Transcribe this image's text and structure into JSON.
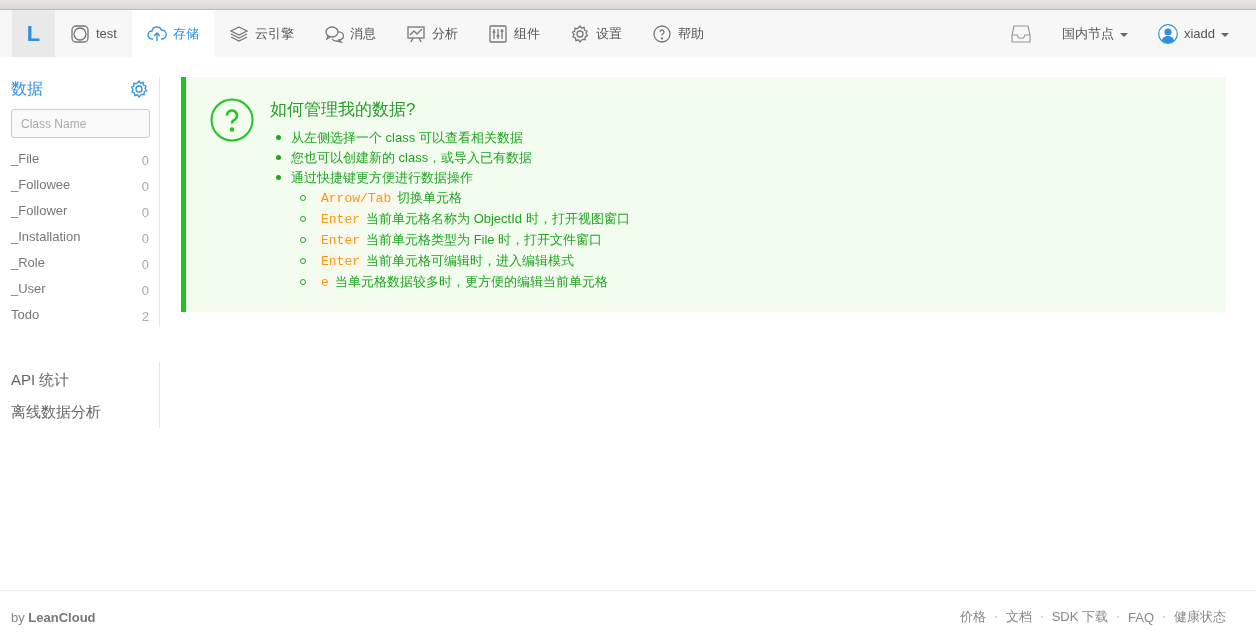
{
  "logo": "L",
  "nav": [
    {
      "kind": "app",
      "label": "test",
      "selected": false
    },
    {
      "kind": "cloud",
      "label": "存储",
      "selected": true
    },
    {
      "kind": "layers",
      "label": "云引擎",
      "selected": false
    },
    {
      "kind": "chat",
      "label": "消息",
      "selected": false
    },
    {
      "kind": "chart",
      "label": "分析",
      "selected": false
    },
    {
      "kind": "sliders",
      "label": "组件",
      "selected": false
    },
    {
      "kind": "gear",
      "label": "设置",
      "selected": false
    },
    {
      "kind": "help",
      "label": "帮助",
      "selected": false
    }
  ],
  "nav_right": {
    "region": "国内节点",
    "user": "xiadd"
  },
  "sidebar": {
    "title": "数据",
    "search": {
      "placeholder": "Class Name"
    },
    "classes": [
      {
        "name": "_File",
        "count": "0"
      },
      {
        "name": "_Followee",
        "count": "0"
      },
      {
        "name": "_Follower",
        "count": "0"
      },
      {
        "name": "_Installation",
        "count": "0"
      },
      {
        "name": "_Role",
        "count": "0"
      },
      {
        "name": "_User",
        "count": "0"
      },
      {
        "name": "Todo",
        "count": "2"
      }
    ],
    "links": [
      "API 统计",
      "离线数据分析"
    ]
  },
  "help": {
    "title": "如何管理我的数据?",
    "items": [
      {
        "text": "从左侧选择一个 class 可以查看相关数据"
      },
      {
        "text": "您也可以创建新的 class，或导入已有数据"
      },
      {
        "text": "通过快捷键更方便进行数据操作",
        "children": [
          {
            "key": "Arrow/Tab",
            "text": "切换单元格"
          },
          {
            "key": "Enter",
            "text": "当前单元格名称为 ObjectId 时，打开视图窗口"
          },
          {
            "key": "Enter",
            "text": "当前单元格类型为 File 时，打开文件窗口"
          },
          {
            "key": "Enter",
            "text": "当前单元格可编辑时，进入编辑模式"
          },
          {
            "key": "e",
            "text": "当单元格数据较多时，更方便的编辑当前单元格"
          }
        ]
      }
    ]
  },
  "footer": {
    "credit": "by **LeanCloud**",
    "links": [
      "价格",
      "文档",
      "SDK 下载",
      "FAQ",
      "健康状态"
    ]
  }
}
